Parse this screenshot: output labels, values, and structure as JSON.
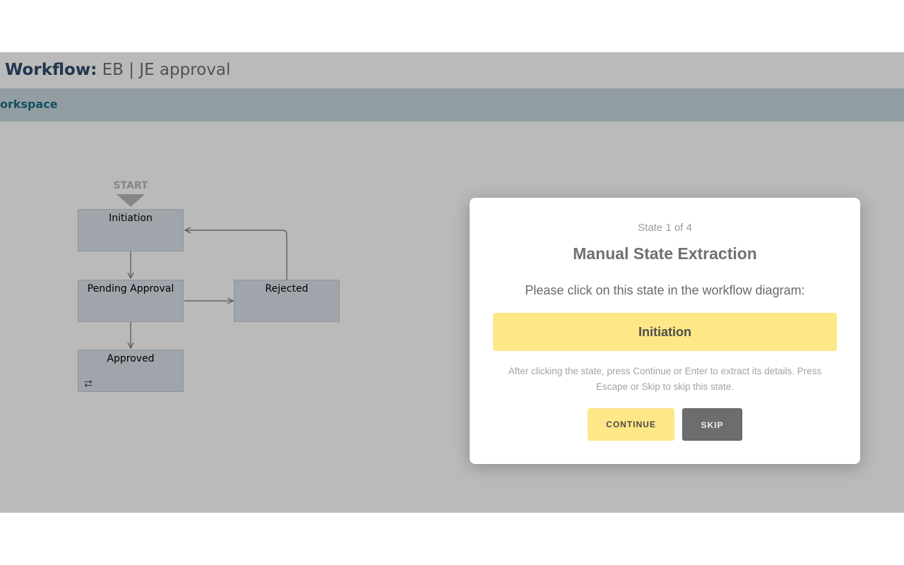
{
  "header": {
    "title_label": "Workflow:",
    "title_value": "EB | JE approval"
  },
  "workspace": {
    "label": "orkspace"
  },
  "diagram": {
    "start_label": "START",
    "states": [
      {
        "name": "Initiation"
      },
      {
        "name": "Pending Approval"
      },
      {
        "name": "Rejected"
      },
      {
        "name": "Approved",
        "icon": "loop-icon"
      }
    ]
  },
  "modal": {
    "step": "State 1 of 4",
    "title": "Manual State Extraction",
    "instruction": "Please click on this state in the workflow diagram:",
    "state_name": "Initiation",
    "hint": "After clicking the state, press Continue or Enter to extract its details. Press Escape or Skip to skip this state.",
    "continue_label": "Continue",
    "skip_label": "Skip"
  },
  "colors": {
    "accent_yellow": "#fde787",
    "skip_gray": "#6d6d70",
    "workspace_teal": "#1f6e86",
    "title_navy": "#2e4a6b"
  }
}
